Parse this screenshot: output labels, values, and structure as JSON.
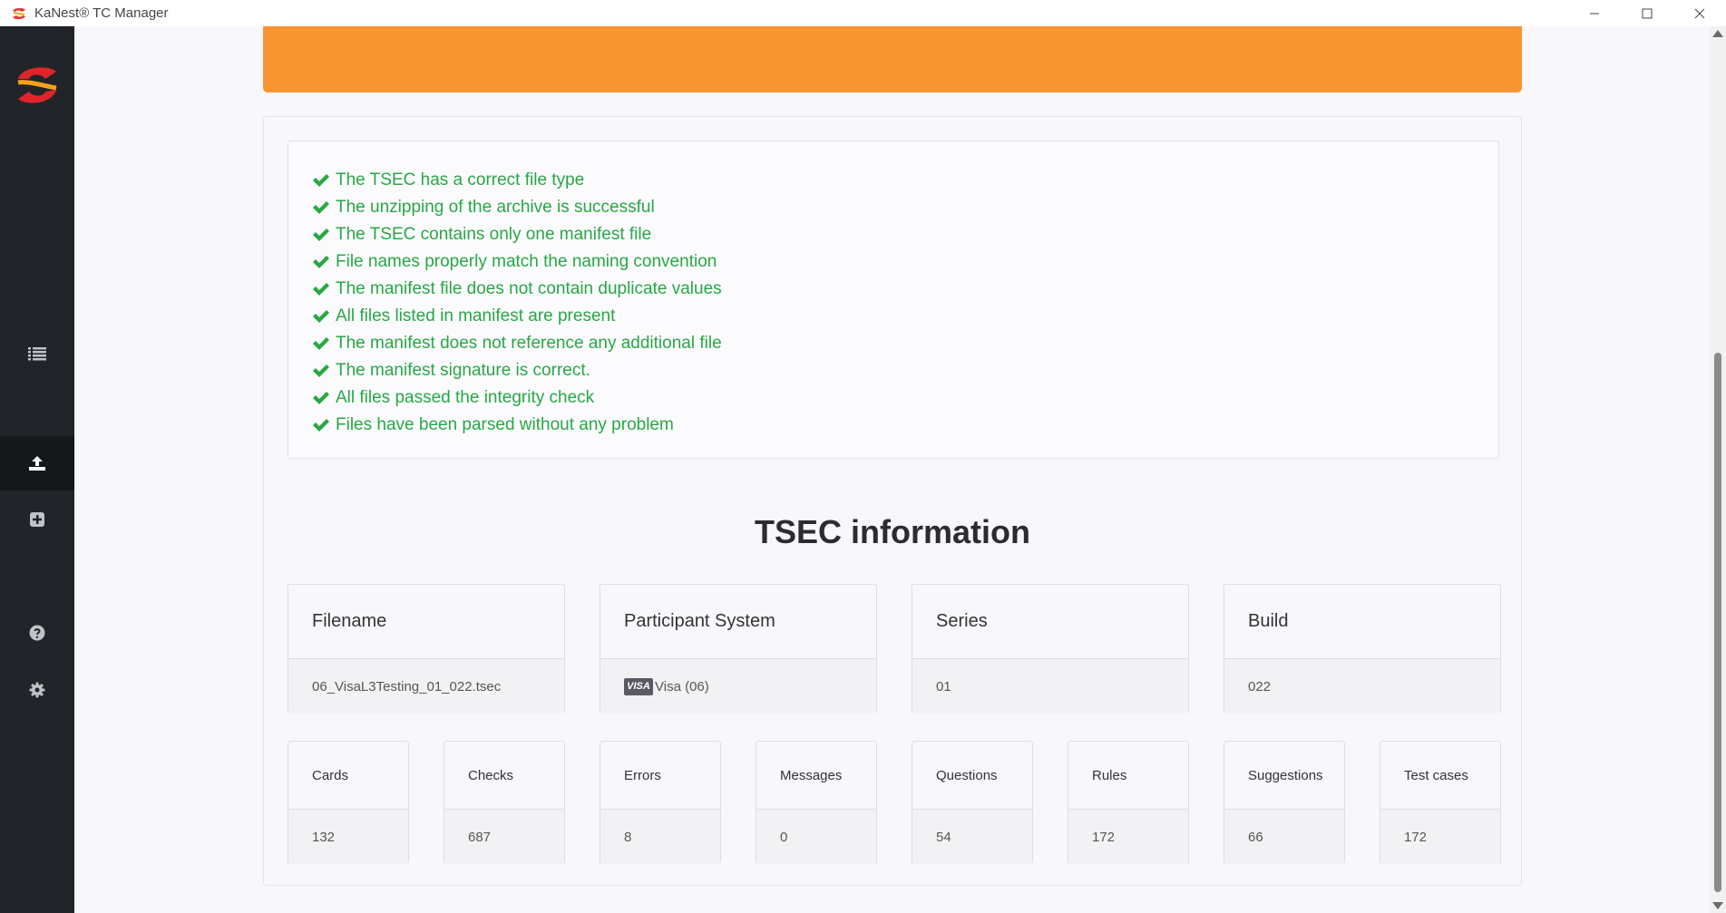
{
  "window": {
    "title": "KaNest® TC Manager",
    "controls": [
      "minimize",
      "maximize",
      "close"
    ]
  },
  "colors": {
    "sidebar": "#212529",
    "banner": "#f89531",
    "success": "#28a745"
  },
  "sidebar": {
    "items": [
      {
        "icon": "list-icon"
      },
      {
        "icon": "upload-icon",
        "active": true
      },
      {
        "icon": "plus-square-icon"
      },
      {
        "icon": "help-icon"
      },
      {
        "icon": "gear-icon"
      }
    ]
  },
  "checks": [
    "The TSEC has a correct file type",
    "The unzipping of the archive is successful",
    "The TSEC contains only one manifest file",
    "File names properly match the naming convention",
    "The manifest file does not contain duplicate values",
    "All files listed in manifest are present",
    "The manifest does not reference any additional file",
    "The manifest signature is correct.",
    "All files passed the integrity check",
    "Files have been parsed without any problem"
  ],
  "tsec": {
    "title": "TSEC information",
    "info": [
      {
        "label": "Filename",
        "value": "06_VisaL3Testing_01_022.tsec"
      },
      {
        "label": "Participant System",
        "badge": "VISA",
        "value": "Visa (06)"
      },
      {
        "label": "Series",
        "value": "01"
      },
      {
        "label": "Build",
        "value": "022"
      }
    ],
    "stats": [
      {
        "label": "Cards",
        "value": "132"
      },
      {
        "label": "Checks",
        "value": "687"
      },
      {
        "label": "Errors",
        "value": "8"
      },
      {
        "label": "Messages",
        "value": "0"
      },
      {
        "label": "Questions",
        "value": "54"
      },
      {
        "label": "Rules",
        "value": "172"
      },
      {
        "label": "Suggestions",
        "value": "66"
      },
      {
        "label": "Test cases",
        "value": "172"
      }
    ]
  }
}
